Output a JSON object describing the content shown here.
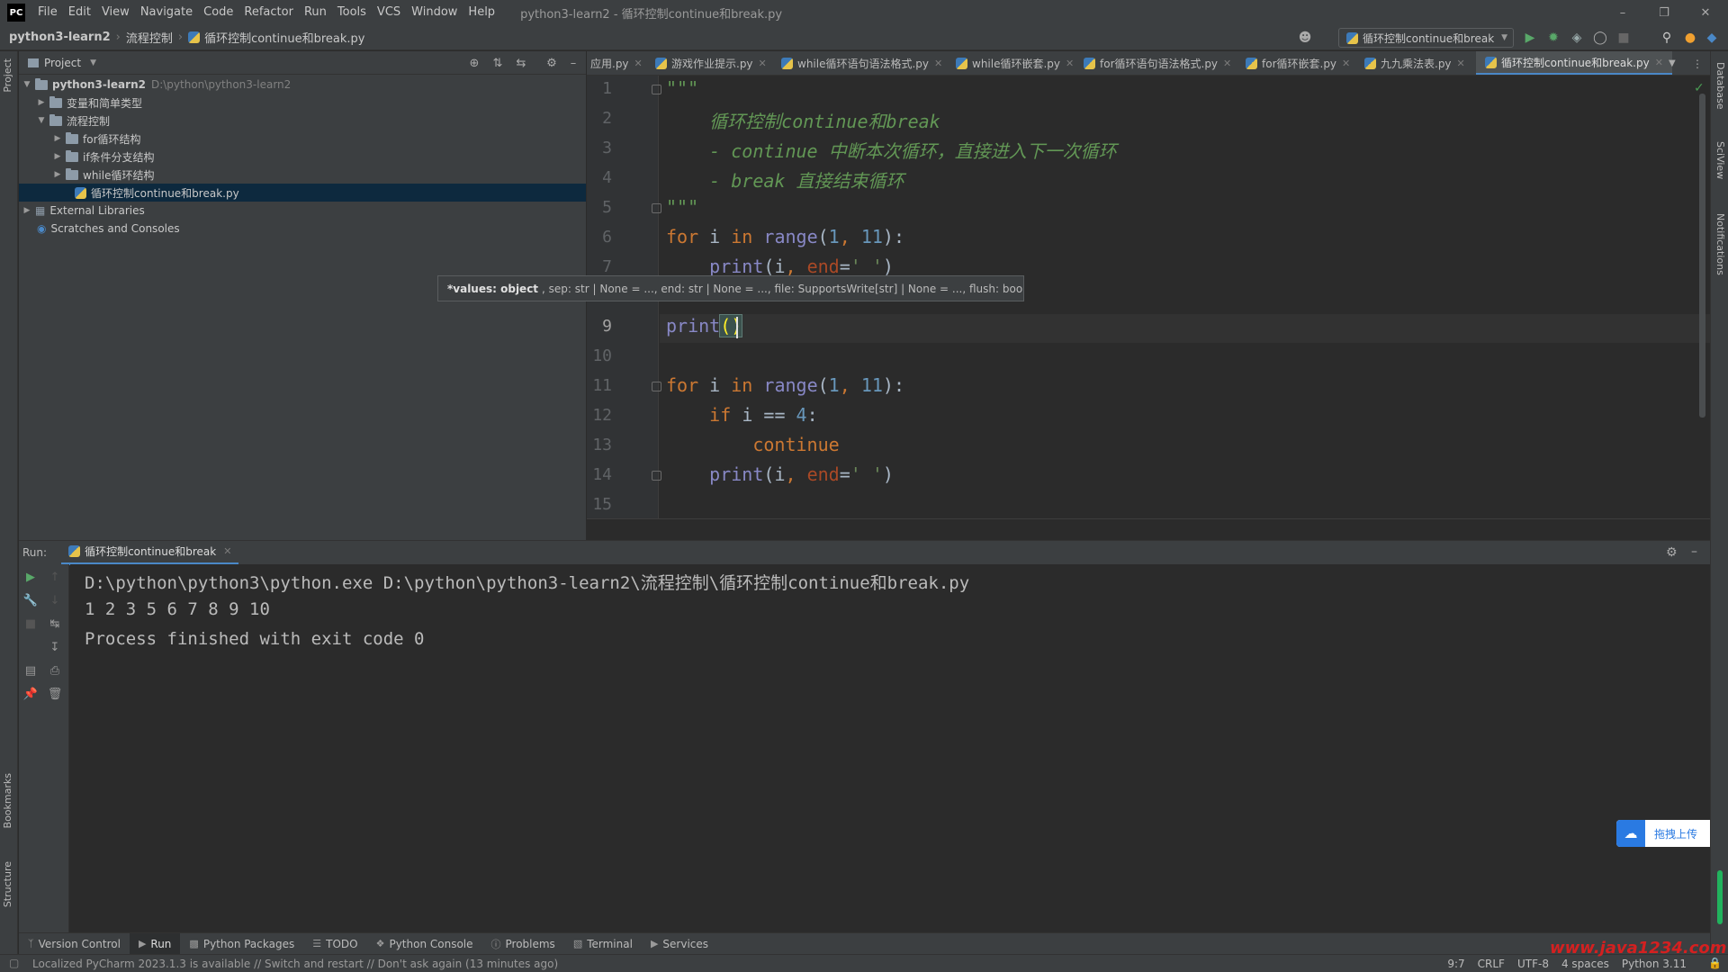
{
  "menu": {
    "items": [
      "File",
      "Edit",
      "View",
      "Navigate",
      "Code",
      "Refactor",
      "Run",
      "Tools",
      "VCS",
      "Window",
      "Help"
    ],
    "window_title": "python3-learn2 - 循环控制continue和break.py"
  },
  "navbar": {
    "crumbs": [
      "python3-learn2",
      "流程控制",
      "循环控制continue和break.py"
    ],
    "run_config": "循环控制continue和break"
  },
  "project": {
    "header": "Project",
    "tree": [
      {
        "label": "python3-learn2",
        "path": "D:\\python\\python3-learn2"
      },
      {
        "label": "变量和简单类型"
      },
      {
        "label": "流程控制"
      },
      {
        "label": "for循环结构"
      },
      {
        "label": "if条件分支结构"
      },
      {
        "label": "while循环结构"
      },
      {
        "label": "循环控制continue和break.py"
      },
      {
        "label": "External Libraries"
      },
      {
        "label": "Scratches and Consoles"
      }
    ]
  },
  "editor": {
    "tabs": [
      "应用.py",
      "游戏作业提示.py",
      "while循环语句语法格式.py",
      "while循环嵌套.py",
      "for循环语句语法格式.py",
      "for循环嵌套.py",
      "九九乘法表.py",
      "循环控制continue和break.py"
    ],
    "line_numbers": [
      "1",
      "2",
      "3",
      "4",
      "5",
      "6",
      "7",
      "9",
      "10",
      "11",
      "12",
      "13",
      "14",
      "15"
    ],
    "lines": {
      "l1": "\"\"\"",
      "l2": "    循环控制continue和break",
      "l3": "    - continue 中断本次循环，直接进入下一次循环",
      "l4": "    - break 直接结束循环",
      "l5": "\"\"\"",
      "kw_for": "for",
      "kw_in": "in",
      "kw_if": "if",
      "kw_continue": "continue",
      "fn_range": "range",
      "fn_print": "print",
      "var_i": "i",
      "param_end": "end",
      "str_space": "' '",
      "num_1": "1",
      "num_11": "11",
      "num_4": "4",
      "op_eq": "==",
      "punct_open": "(",
      "punct_comma": ", ",
      "punct_close": ")",
      "punct_colon": ":",
      "punct_eq": "=",
      "punct_parens": "()"
    },
    "tooltip": {
      "bold": "*values: object",
      "rest": ", sep: str | None = ..., end: str | None = ..., file: SupportsWrite[str] | None = ..., flush: bool = ..."
    }
  },
  "run": {
    "label": "Run:",
    "tab": "循环控制continue和break",
    "console": [
      "D:\\python\\python3\\python.exe D:\\python\\python3-learn2\\流程控制\\循环控制continue和break.py",
      "1 2 3 5 6 7 8 9 10",
      "Process finished with exit code 0"
    ]
  },
  "upload": {
    "label": "拖拽上传"
  },
  "toolbar": {
    "items": [
      "Version Control",
      "Run",
      "Python Packages",
      "TODO",
      "Python Console",
      "Problems",
      "Terminal",
      "Services"
    ]
  },
  "sidebars": {
    "left": [
      "Project",
      "Bookmarks",
      "Structure"
    ],
    "right": [
      "Database",
      "SciView",
      "Notifications"
    ]
  },
  "status": {
    "message": "Localized PyCharm 2023.1.3 is available // Switch and restart // Don't ask again (13 minutes ago)",
    "position": "9:7",
    "line_sep": "CRLF",
    "encoding": "UTF-8",
    "indent": "4 spaces",
    "interpreter": "Python 3.11"
  },
  "watermark": "www.java1234.com",
  "colors": {
    "accent": "#4a88c7",
    "keyword": "#cc7832",
    "number": "#6897bb",
    "docstring": "#629755"
  }
}
